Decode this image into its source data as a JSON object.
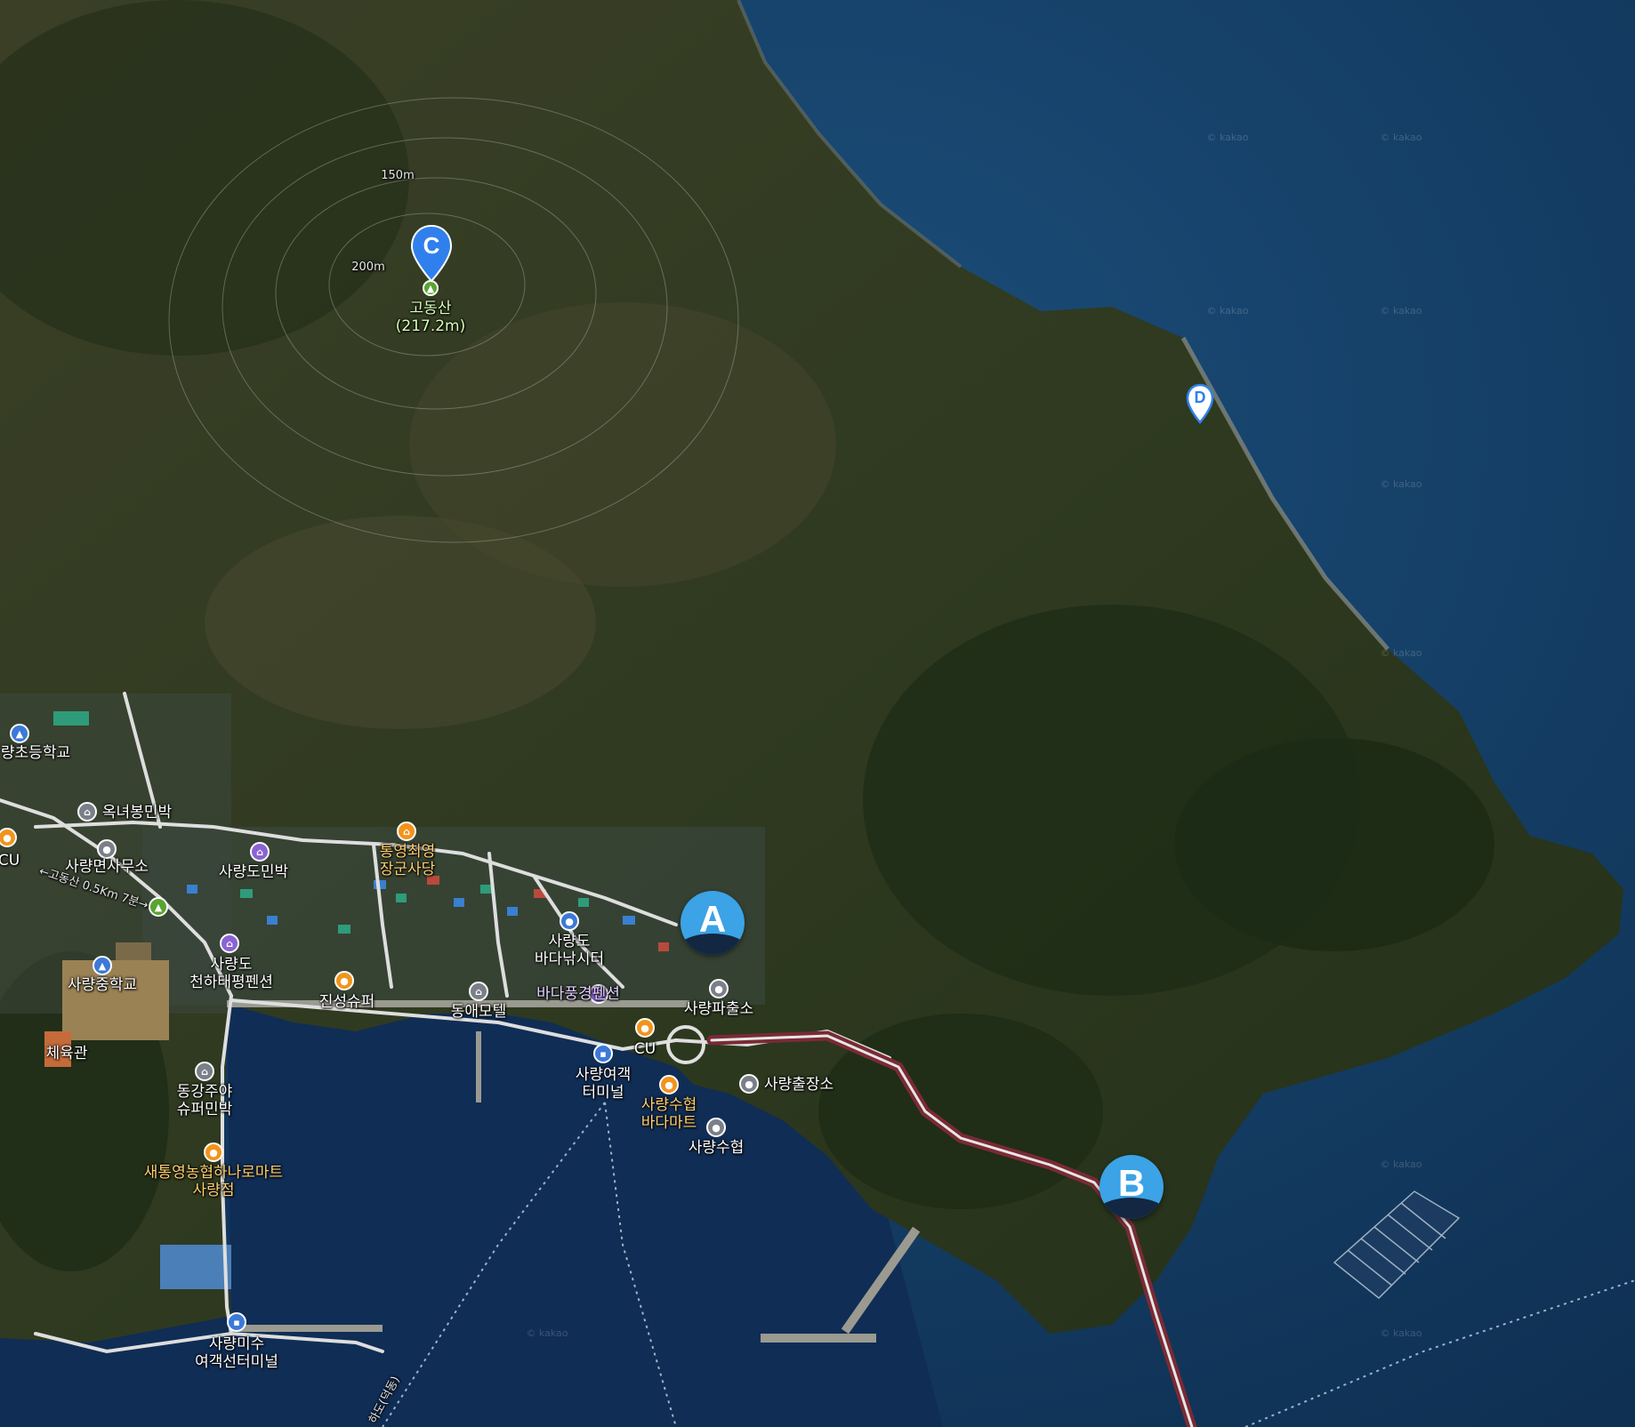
{
  "map": {
    "peak": {
      "name": "고동산",
      "elevation": "(217.2m)"
    },
    "contours": [
      "150m",
      "200m"
    ],
    "markers": [
      {
        "id": "A",
        "letter": "A"
      },
      {
        "id": "B",
        "letter": "B"
      },
      {
        "id": "C",
        "letter": "C"
      },
      {
        "id": "D",
        "letter": "D"
      }
    ],
    "labels": {
      "school_elem": "량초등학교",
      "okneobong": "옥녀봉민박",
      "office": "사량면사무소",
      "cu_left": "CU",
      "trail": "←고동산 0.5Km 7분→",
      "minbak": "사량도민박",
      "middle_school": "사량중학교",
      "tongyeong_1": "통영최영",
      "tongyeong_2": "장군사당",
      "fishing_1": "사량도",
      "fishing_2": "바다낚시터",
      "heaven_1": "사량도",
      "heaven_2": "천하태평펜션",
      "jinseong": "진성슈퍼",
      "dongae": "동애모텔",
      "badapung": "바다풍경펜션",
      "police": "사량파출소",
      "cu_center": "CU",
      "gym": "체육관",
      "donggang_1": "동강주야",
      "donggang_2": "슈퍼민박",
      "terminal_1": "사량여객",
      "terminal_2": "터미널",
      "office2": "사량출장소",
      "suhyup_mart_1": "사량수협",
      "suhyup_mart_2": "바다마트",
      "suhyup": "사량수협",
      "nonghyup_1": "새통영농협하나로마트",
      "nonghyup_2": "사량점",
      "misu_1": "사량미수",
      "misu_2": "여객선터미널",
      "ferry_route": "하도(덕동)"
    },
    "watermark": "© kakao"
  }
}
